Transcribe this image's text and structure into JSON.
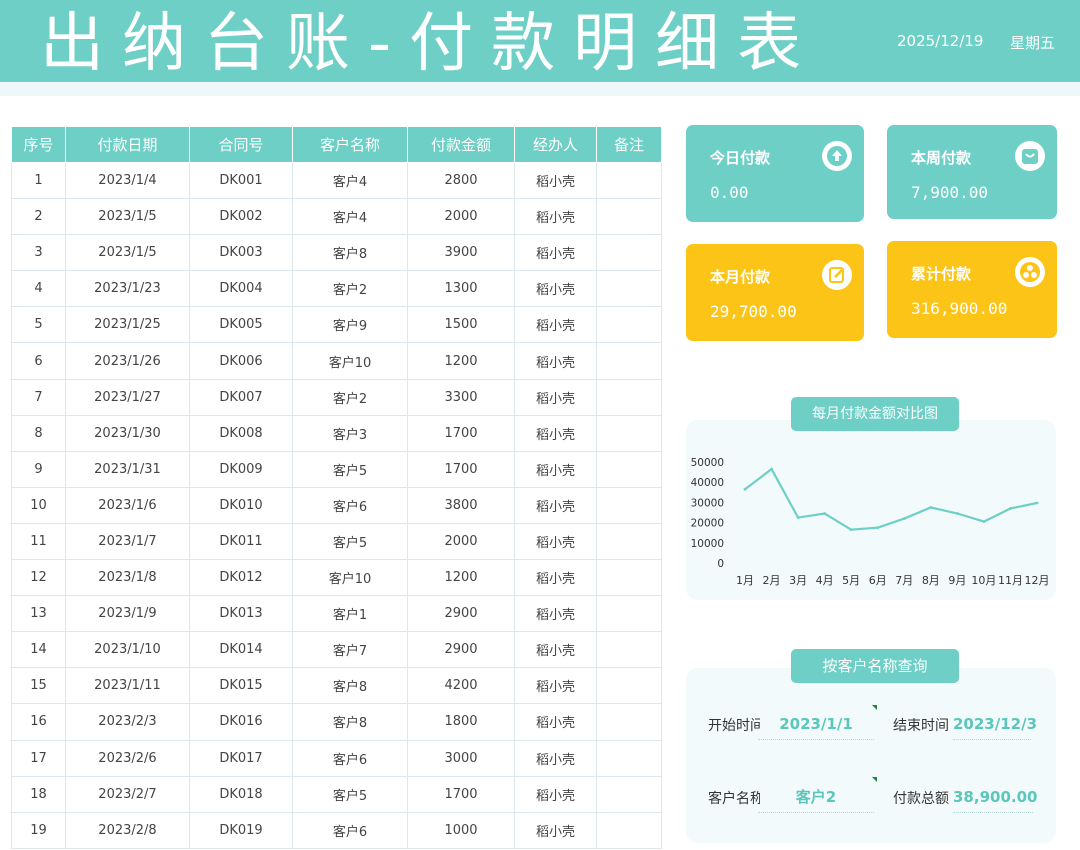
{
  "header": {
    "title": "出纳台账-付款明细表",
    "date": "2025/12/19",
    "weekday": "星期五"
  },
  "table": {
    "columns": [
      "序号",
      "付款日期",
      "合同号",
      "客户名称",
      "付款金额",
      "经办人",
      "备注"
    ],
    "rows": [
      [
        "1",
        "2023/1/4",
        "DK001",
        "客户4",
        "2800",
        "稻小壳",
        ""
      ],
      [
        "2",
        "2023/1/5",
        "DK002",
        "客户4",
        "2000",
        "稻小壳",
        ""
      ],
      [
        "3",
        "2023/1/5",
        "DK003",
        "客户8",
        "3900",
        "稻小壳",
        ""
      ],
      [
        "4",
        "2023/1/23",
        "DK004",
        "客户2",
        "1300",
        "稻小壳",
        ""
      ],
      [
        "5",
        "2023/1/25",
        "DK005",
        "客户9",
        "1500",
        "稻小壳",
        ""
      ],
      [
        "6",
        "2023/1/26",
        "DK006",
        "客户10",
        "1200",
        "稻小壳",
        ""
      ],
      [
        "7",
        "2023/1/27",
        "DK007",
        "客户2",
        "3300",
        "稻小壳",
        ""
      ],
      [
        "8",
        "2023/1/30",
        "DK008",
        "客户3",
        "1700",
        "稻小壳",
        ""
      ],
      [
        "9",
        "2023/1/31",
        "DK009",
        "客户5",
        "1700",
        "稻小壳",
        ""
      ],
      [
        "10",
        "2023/1/6",
        "DK010",
        "客户6",
        "3800",
        "稻小壳",
        ""
      ],
      [
        "11",
        "2023/1/7",
        "DK011",
        "客户5",
        "2000",
        "稻小壳",
        ""
      ],
      [
        "12",
        "2023/1/8",
        "DK012",
        "客户10",
        "1200",
        "稻小壳",
        ""
      ],
      [
        "13",
        "2023/1/9",
        "DK013",
        "客户1",
        "2900",
        "稻小壳",
        ""
      ],
      [
        "14",
        "2023/1/10",
        "DK014",
        "客户7",
        "2900",
        "稻小壳",
        ""
      ],
      [
        "15",
        "2023/1/11",
        "DK015",
        "客户8",
        "4200",
        "稻小壳",
        ""
      ],
      [
        "16",
        "2023/2/3",
        "DK016",
        "客户8",
        "1800",
        "稻小壳",
        ""
      ],
      [
        "17",
        "2023/2/6",
        "DK017",
        "客户6",
        "3000",
        "稻小壳",
        ""
      ],
      [
        "18",
        "2023/2/7",
        "DK018",
        "客户5",
        "1700",
        "稻小壳",
        ""
      ],
      [
        "19",
        "2023/2/8",
        "DK019",
        "客户6",
        "1000",
        "稻小壳",
        ""
      ]
    ]
  },
  "cards": {
    "today": {
      "label": "今日付款",
      "value": "0.00",
      "icon": "upload-arrow-icon"
    },
    "week": {
      "label": "本周付款",
      "value": "7,900.00",
      "icon": "calendar-icon"
    },
    "month": {
      "label": "本月付款",
      "value": "29,700.00",
      "icon": "edit-note-icon"
    },
    "total": {
      "label": "累计付款",
      "value": "316,900.00",
      "icon": "coins-icon"
    }
  },
  "chart_data": {
    "type": "line",
    "title": "每月付款金额对比图",
    "categories": [
      "1月",
      "2月",
      "3月",
      "4月",
      "5月",
      "6月",
      "7月",
      "8月",
      "9月",
      "10月",
      "11月",
      "12月"
    ],
    "values": [
      36500,
      46500,
      22500,
      24500,
      16500,
      17500,
      22000,
      27500,
      24500,
      20500,
      27000,
      29700
    ],
    "ylim": [
      0,
      50000
    ],
    "yticks": [
      "0",
      "10000",
      "20000",
      "30000",
      "40000",
      "50000"
    ],
    "grid": false,
    "line_color": "#6dcfc6"
  },
  "query": {
    "title": "按客户名称查询",
    "start_label": "开始时间",
    "start_value": "2023/1/1",
    "end_label": "结束时间",
    "end_value": "2023/12/3",
    "customer_label": "客户名称",
    "customer_value": "客户2",
    "total_label": "付款总额",
    "total_value": "38,900.00"
  },
  "colors": {
    "teal": "#6dcfc6",
    "yellow": "#fcc417",
    "accent_text": "#59c7bb"
  }
}
